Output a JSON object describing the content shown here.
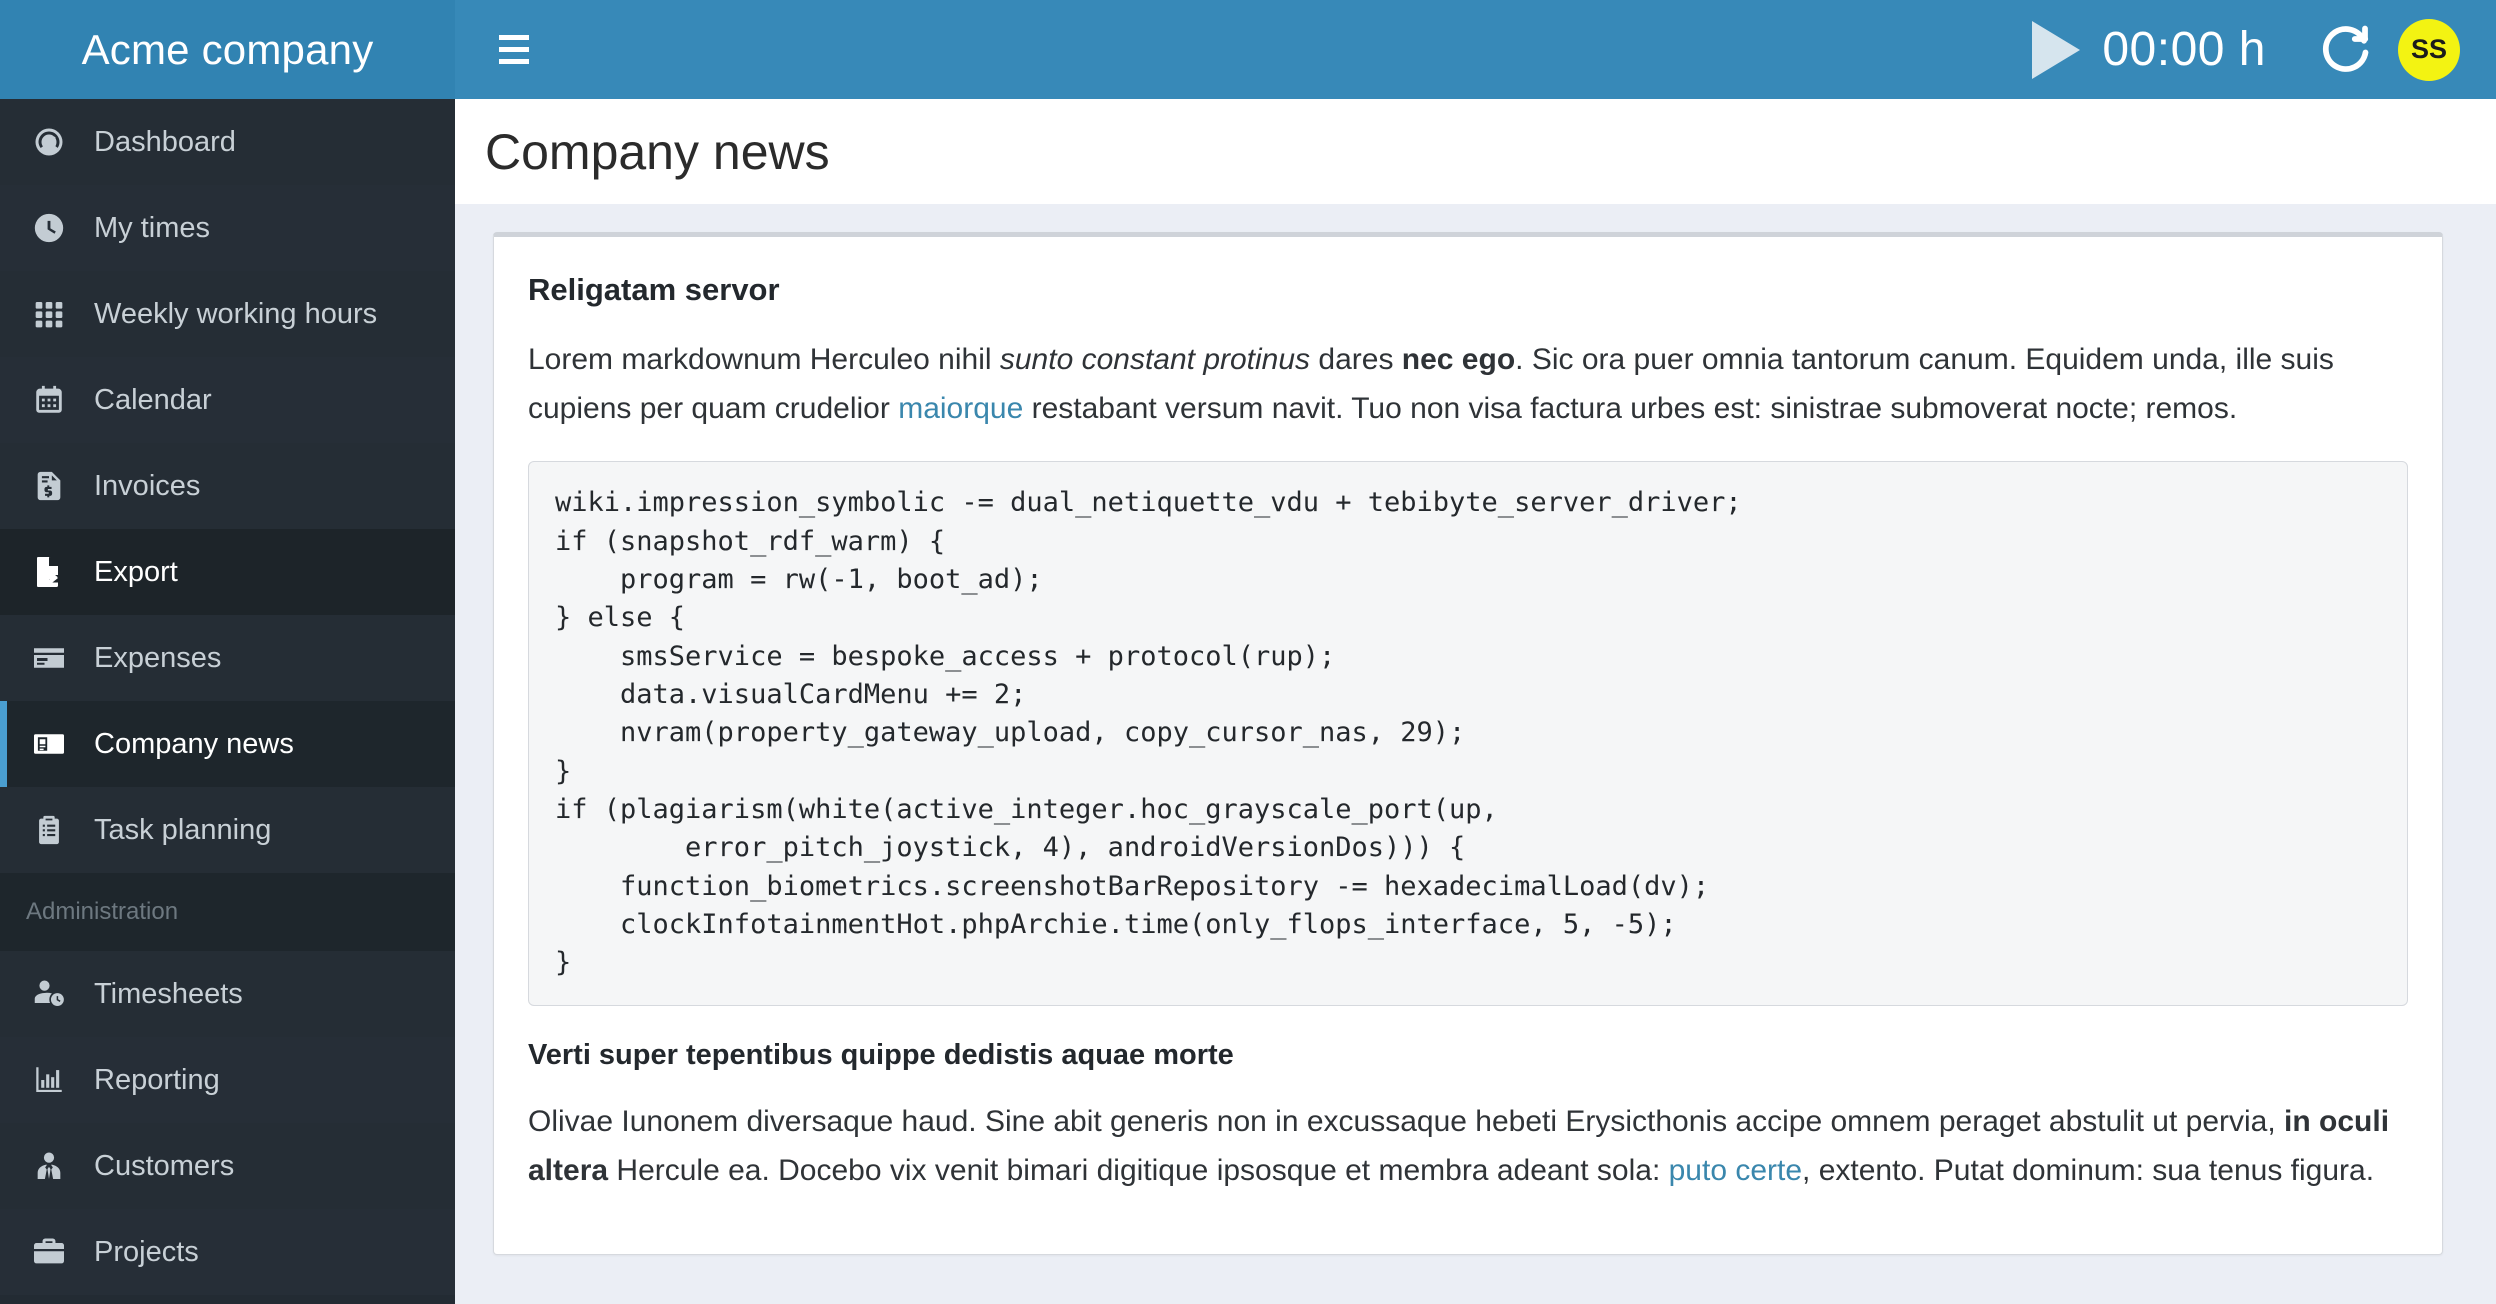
{
  "brand": {
    "name": "Acme company"
  },
  "sidebar": {
    "items": [
      {
        "label": "Dashboard",
        "icon": "dashboard-gauge-icon",
        "state": "normal"
      },
      {
        "label": "My times",
        "icon": "clock-icon",
        "state": "normal"
      },
      {
        "label": "Weekly working hours",
        "icon": "grid-icon",
        "state": "normal"
      },
      {
        "label": "Calendar",
        "icon": "calendar-icon",
        "state": "normal"
      },
      {
        "label": "Invoices",
        "icon": "invoice-icon",
        "state": "normal"
      },
      {
        "label": "Export",
        "icon": "export-icon",
        "state": "hovered"
      },
      {
        "label": "Expenses",
        "icon": "credit-card-icon",
        "state": "normal"
      },
      {
        "label": "Company news",
        "icon": "newspaper-icon",
        "state": "active"
      },
      {
        "label": "Task planning",
        "icon": "clipboard-list-icon",
        "state": "normal"
      }
    ],
    "section_label": "Administration",
    "admin_items": [
      {
        "label": "Timesheets",
        "icon": "user-clock-icon",
        "state": "normal"
      },
      {
        "label": "Reporting",
        "icon": "bar-chart-icon",
        "state": "normal"
      },
      {
        "label": "Customers",
        "icon": "user-tie-icon",
        "state": "normal"
      },
      {
        "label": "Projects",
        "icon": "briefcase-icon",
        "state": "normal"
      }
    ]
  },
  "topbar": {
    "menu_icon": "hamburger-menu-icon",
    "timer_value": "00:00 h",
    "play_icon": "play-icon",
    "reload_icon": "reload-icon",
    "avatar_initials": "SS"
  },
  "page": {
    "title": "Company news"
  },
  "post": {
    "title": "Religatam servor",
    "paragraph": {
      "t1": "Lorem markdownum Herculeo nihil ",
      "em1": "sunto constant protinus",
      "t2": " dares ",
      "b1": "nec ego",
      "t3": ". Sic ora puer omnia tantorum canum. Equidem unda, ille suis cupiens per quam crudelior ",
      "link1": "maiorque",
      "t4": " restabant versum navit. Tuo non visa factura urbes est: sinistrae submoverat nocte; remos."
    },
    "code": "wiki.impression_symbolic -= dual_netiquette_vdu + tebibyte_server_driver;\nif (snapshot_rdf_warm) {\n    program = rw(-1, boot_ad);\n} else {\n    smsService = bespoke_access + protocol(rup);\n    data.visualCardMenu += 2;\n    nvram(property_gateway_upload, copy_cursor_nas, 29);\n}\nif (plagiarism(white(active_integer.hoc_grayscale_port(up,\n        error_pitch_joystick, 4), androidVersionDos))) {\n    function_biometrics.screenshotBarRepository -= hexadecimalLoad(dv);\n    clockInfotainmentHot.phpArchie.time(only_flops_interface, 5, -5);\n}",
    "title2": "Verti super tepentibus quippe dedistis aquae morte",
    "paragraph2": {
      "t1": "Olivae Iunonem diversaque haud. Sine abit generis non in excussaque hebeti Erysicthonis accipe omnem peraget abstulit ut pervia, ",
      "b1": "in oculi altera",
      "t2": " Hercule ea. Docebo vix venit bimari digitique ipsosque et membra adeant sola: ",
      "link1": "puto certe",
      "t3": ", extento. Putat dominum: sua tenus figura."
    }
  },
  "colors": {
    "brand_blue": "#3183b2",
    "topbar_blue": "#3789b8",
    "sidebar_dark": "#252d35",
    "active_border": "#4a9ed0",
    "avatar_yellow": "#f3f312",
    "link": "#3a87ad",
    "page_bg": "#ebeef5"
  }
}
